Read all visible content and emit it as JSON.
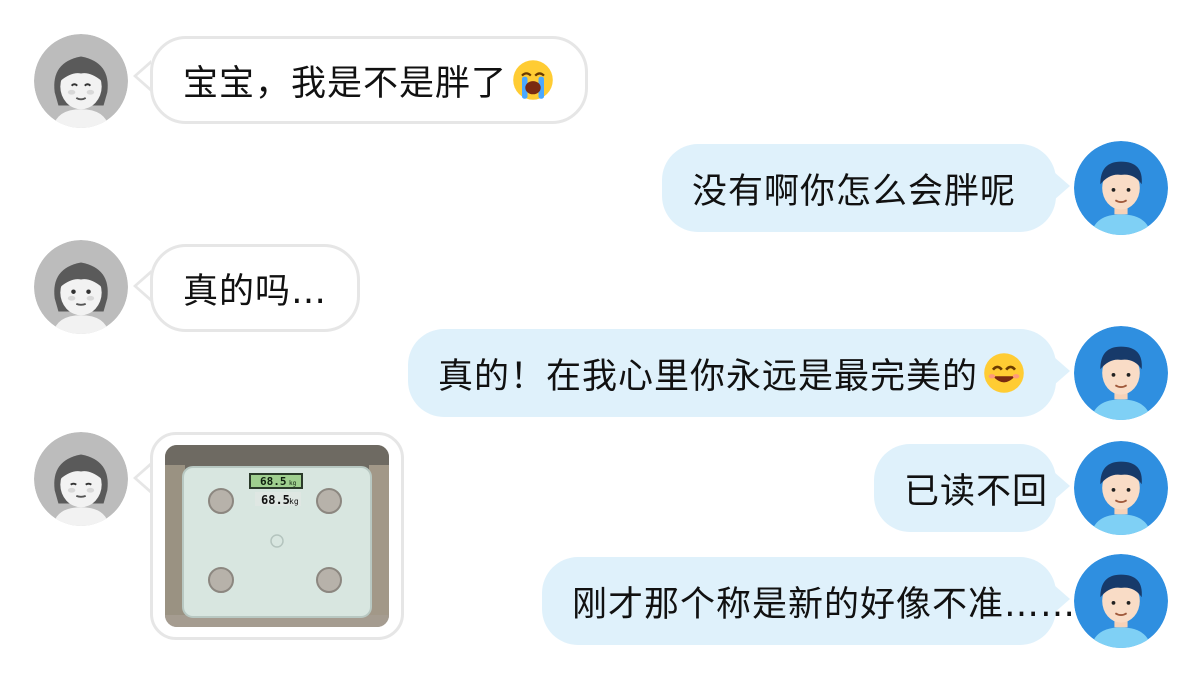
{
  "chat": {
    "messages": [
      {
        "side": "left",
        "text": "宝宝，我是不是胖了",
        "emoji": "loudly-crying-face"
      },
      {
        "side": "right",
        "text": "没有啊你怎么会胖呢"
      },
      {
        "side": "left",
        "text": "真的吗…"
      },
      {
        "side": "right",
        "text": "真的！在我心里你永远是最完美的",
        "emoji": "smiling-face"
      },
      {
        "side": "left",
        "type": "image",
        "image": {
          "description_icon": "bathroom-scale",
          "display_top": "68.5",
          "display_top_unit": "kg",
          "display_bottom": "68.5",
          "display_bottom_unit": "kg"
        }
      },
      {
        "side": "right",
        "text": "已读不回"
      },
      {
        "side": "right",
        "text": "刚才那个称是新的好像不准……"
      }
    ]
  },
  "colors": {
    "left_bubble": "#ffffff",
    "left_border": "#e6e6e6",
    "right_bubble": "#dff1fb",
    "female_avatar_bg": "#b9b9b9",
    "male_avatar_bg": "#2f8fe0"
  }
}
